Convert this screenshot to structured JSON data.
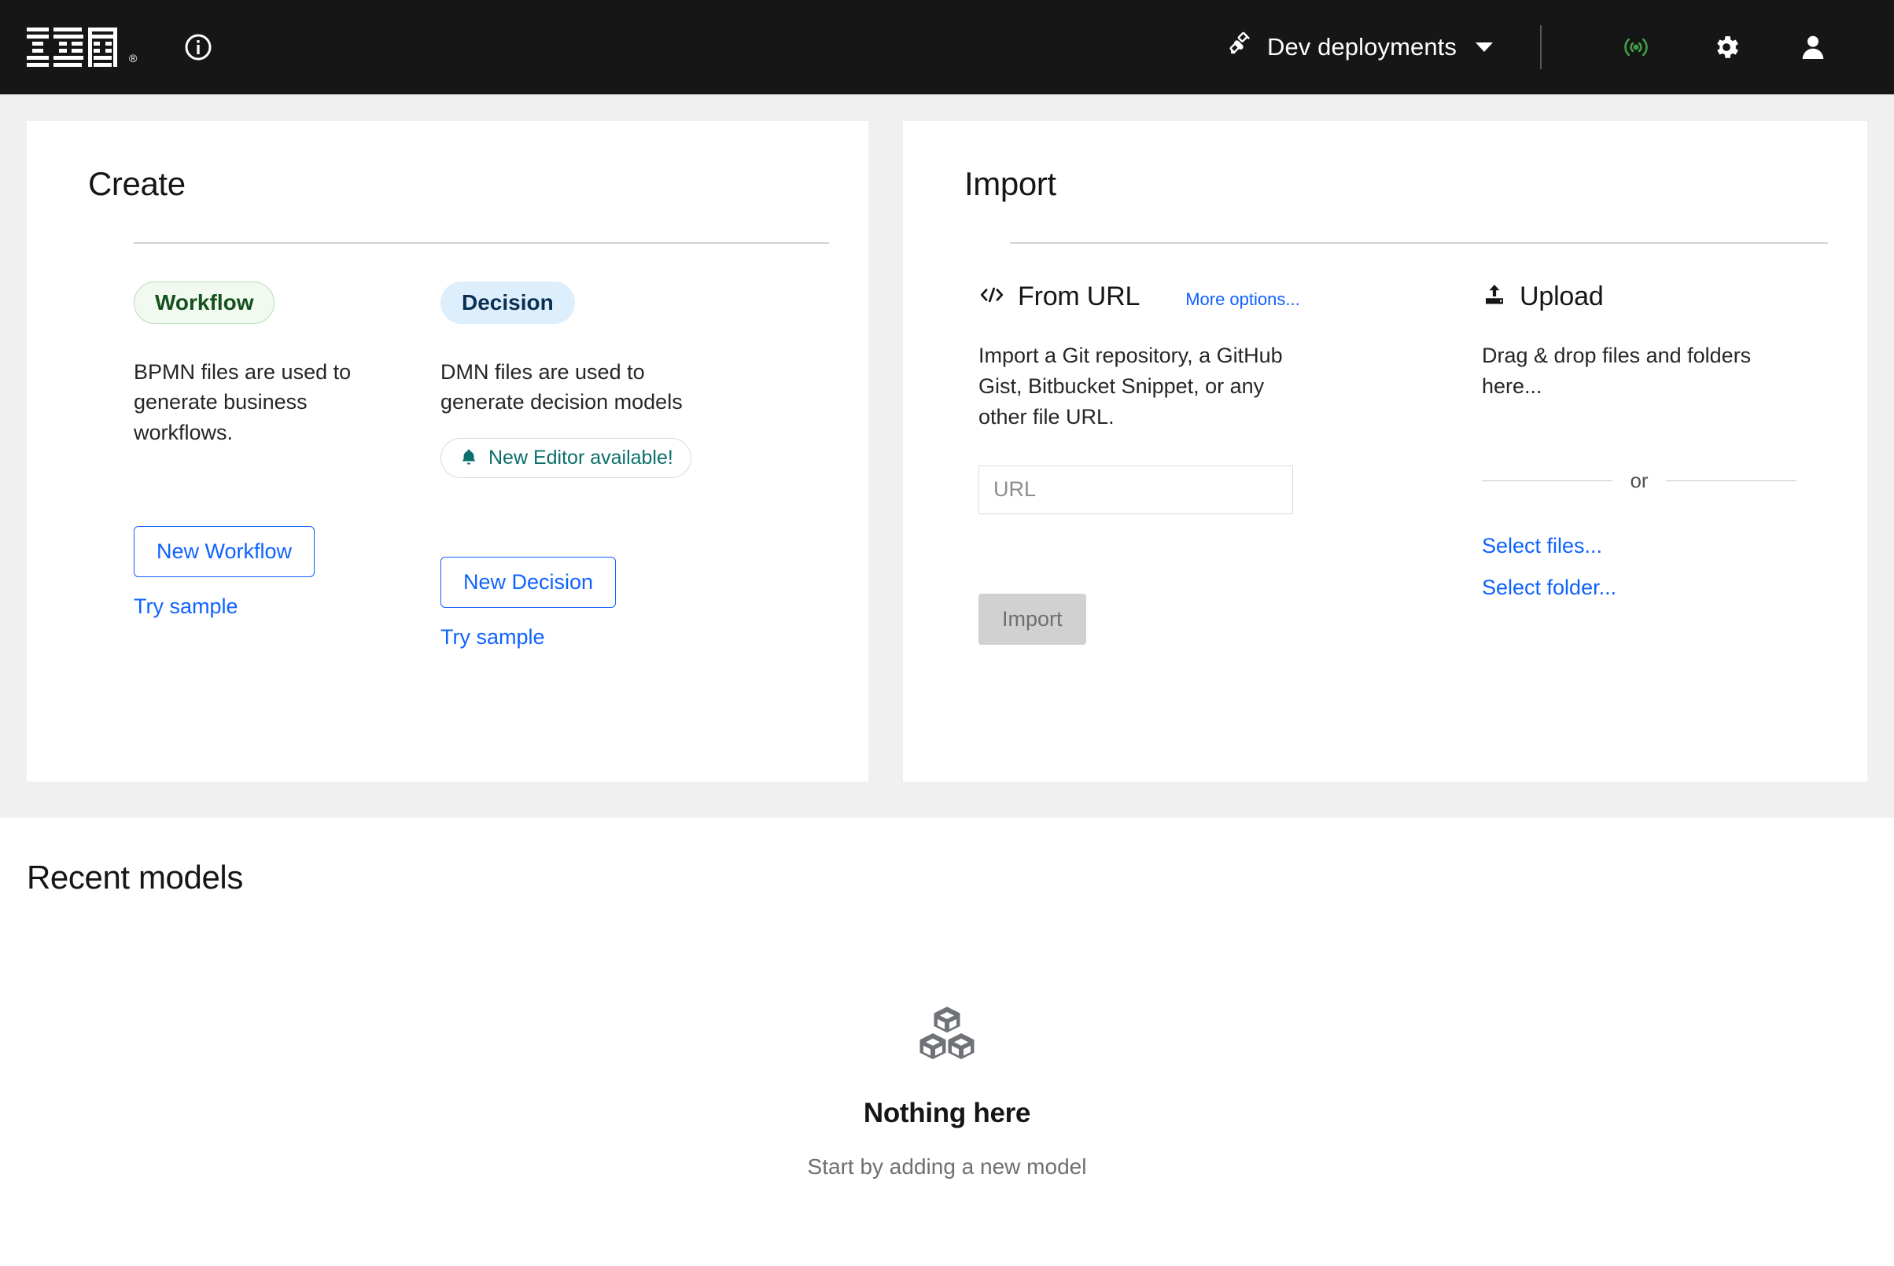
{
  "header": {
    "logo_alt": "IBM",
    "registered_mark": "®",
    "info_icon": "info-icon",
    "deployments": {
      "label": "Dev deployments",
      "icon": "satellite-icon",
      "caret": "chevron-down-icon"
    },
    "status_icon": "broadcast-signal-icon",
    "settings_icon": "gear-icon",
    "account_icon": "user-avatar-icon",
    "accent_green": "#3f9c45",
    "background": "#161616"
  },
  "create": {
    "title": "Create",
    "columns": [
      {
        "badge": "Workflow",
        "badge_type": "workflow",
        "description": "BPMN files are used to generate business workflows.",
        "button_label": "New Workflow",
        "sample_link": "Try sample",
        "notice": null
      },
      {
        "badge": "Decision",
        "badge_type": "decision",
        "description": "DMN files are used to generate decision models",
        "button_label": "New Decision",
        "sample_link": "Try sample",
        "notice": "New Editor available!",
        "notice_icon": "bell-icon"
      }
    ]
  },
  "import": {
    "title": "Import",
    "from_url": {
      "heading": "From URL",
      "icon": "code-brackets-icon",
      "more_options": "More options...",
      "description": "Import a Git repository, a GitHub Gist, Bitbucket Snippet, or any other file URL.",
      "input_placeholder": "URL",
      "input_value": "",
      "submit_label": "Import",
      "submit_disabled": true
    },
    "upload": {
      "heading": "Upload",
      "icon": "upload-icon",
      "description": "Drag & drop files and folders here...",
      "or_text": "or",
      "select_files": "Select files...",
      "select_folder": "Select folder..."
    }
  },
  "recent": {
    "title": "Recent models",
    "empty_icon": "boxes-icon",
    "empty_title": "Nothing here",
    "empty_subtitle": "Start by adding a new model"
  },
  "colors": {
    "accent_blue": "#0f62fe",
    "teal": "#0c6f6b",
    "workflow_green": "#14521c",
    "decision_navy": "#0b2f52",
    "page_gray": "#f0f0f0"
  }
}
